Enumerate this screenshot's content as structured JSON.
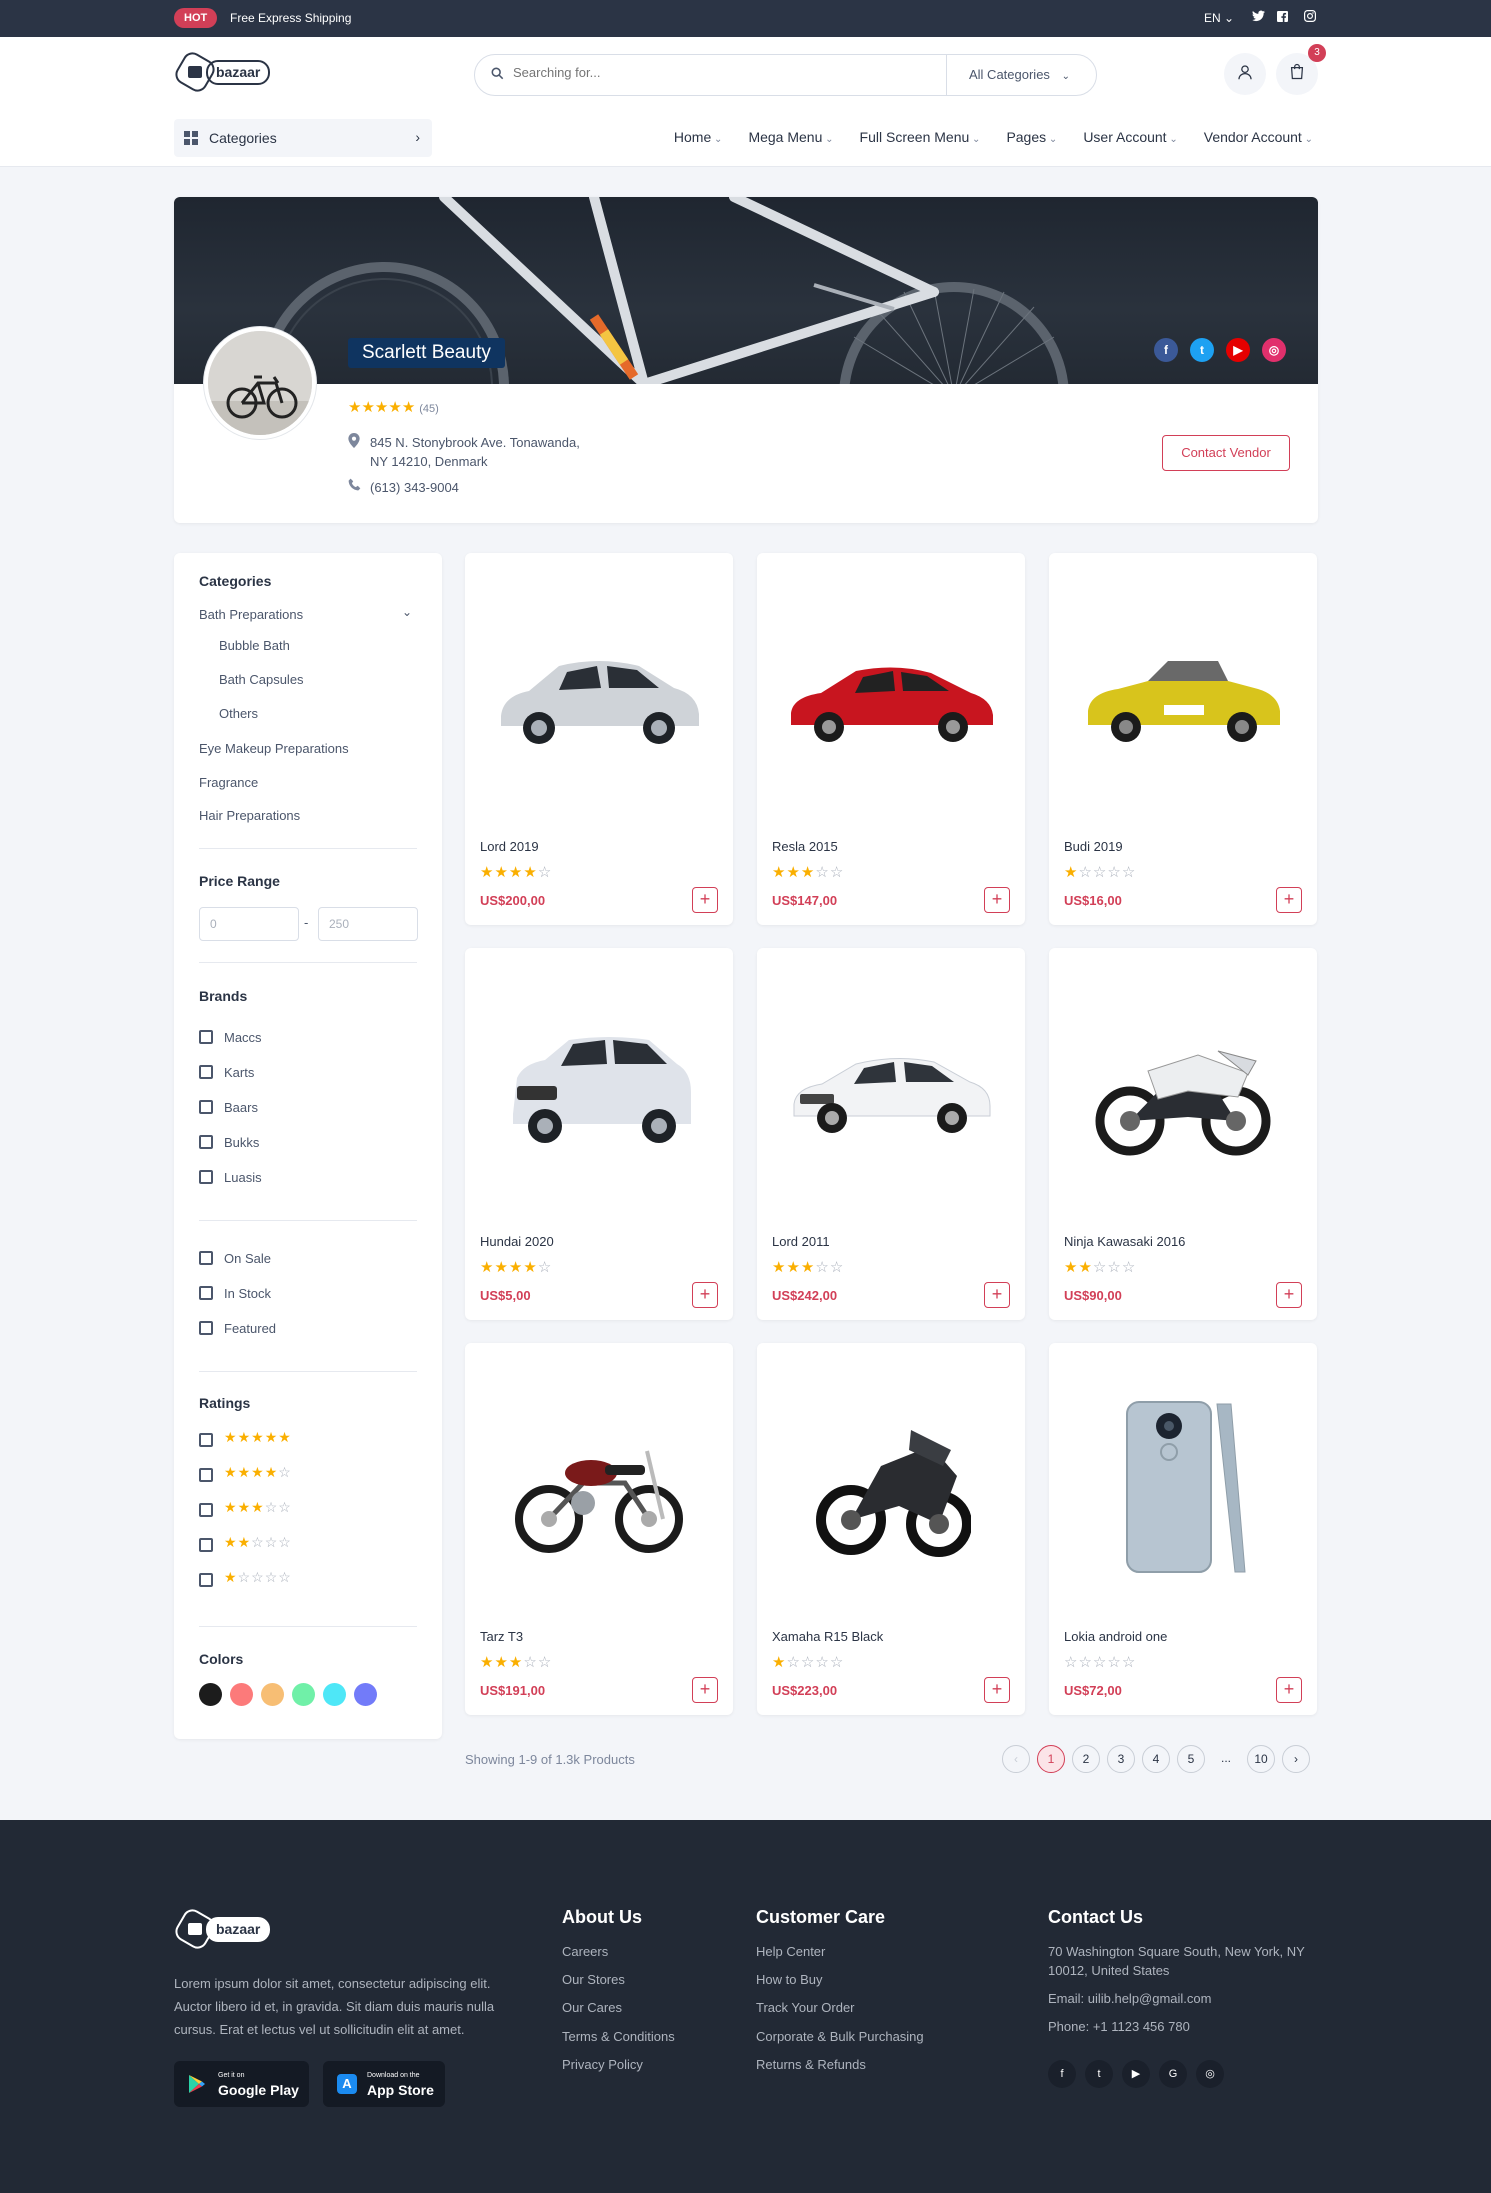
{
  "topbar": {
    "badge": "HOT",
    "shipping": "Free Express Shipping",
    "language": "EN"
  },
  "header": {
    "logo": "bazaar",
    "search_placeholder": "Searching for...",
    "search_category": "All Categories",
    "cart_count": "3"
  },
  "nav": {
    "categories_label": "Categories",
    "items": [
      "Home",
      "Mega Menu",
      "Full Screen Menu",
      "Pages",
      "User Account",
      "Vendor Account"
    ]
  },
  "shop": {
    "name": "Scarlett Beauty",
    "rating": 5,
    "review_count": "(45)",
    "address_line1": "845 N. Stonybrook Ave. Tonawanda,",
    "address_line2": "NY 14210, Denmark",
    "phone": "(613) 343-9004",
    "contact_label": "Contact Vendor"
  },
  "sidebar": {
    "categories_title": "Categories",
    "categories": [
      {
        "label": "Bath Preparations",
        "children": [
          "Bubble Bath",
          "Bath Capsules",
          "Others"
        ]
      },
      {
        "label": "Eye Makeup Preparations"
      },
      {
        "label": "Fragrance"
      },
      {
        "label": "Hair Preparations"
      }
    ],
    "price_title": "Price Range",
    "price_min_placeholder": "0",
    "price_max_placeholder": "250",
    "price_separator": "-",
    "brands_title": "Brands",
    "brands": [
      "Maccs",
      "Karts",
      "Baars",
      "Bukks",
      "Luasis"
    ],
    "flags": [
      "On Sale",
      "In Stock",
      "Featured"
    ],
    "ratings_title": "Ratings",
    "ratings": [
      5,
      4,
      3,
      2,
      1
    ],
    "colors_title": "Colors",
    "colors": [
      "#1c1c1c",
      "#fc7a7a",
      "#f7be74",
      "#70f0a8",
      "#4ee7f7",
      "#727bf9"
    ]
  },
  "products": [
    {
      "name": "Lord 2019",
      "rating": 4,
      "price": "US$200,00",
      "image": "silver-suv"
    },
    {
      "name": "Resla 2015",
      "rating": 3,
      "price": "US$147,00",
      "image": "red-coupe"
    },
    {
      "name": "Budi 2019",
      "rating": 1,
      "price": "US$16,00",
      "image": "yellow-roadster"
    },
    {
      "name": "Hundai 2020",
      "rating": 4,
      "price": "US$5,00",
      "image": "white-suv"
    },
    {
      "name": "Lord 2011",
      "rating": 3,
      "price": "US$242,00",
      "image": "white-sedan"
    },
    {
      "name": "Ninja Kawasaki 2016",
      "rating": 2,
      "price": "US$90,00",
      "image": "sport-bike"
    },
    {
      "name": "Tarz T3",
      "rating": 3,
      "price": "US$191,00",
      "image": "classic-motorcycle"
    },
    {
      "name": "Xamaha R15 Black",
      "rating": 1,
      "price": "US$223,00",
      "image": "black-sportbike"
    },
    {
      "name": "Lokia android one",
      "rating": 0,
      "price": "US$72,00",
      "image": "smartphone"
    }
  ],
  "pagination": {
    "showing": "Showing 1-9 of 1.3k Products",
    "prev": "‹",
    "next": "›",
    "pages": [
      "1",
      "2",
      "3",
      "4",
      "5",
      "...",
      "10"
    ],
    "current": "1"
  },
  "footer": {
    "logo": "bazaar",
    "description": "Lorem ipsum dolor sit amet, consectetur adipiscing elit. Auctor libero id et, in gravida. Sit diam duis mauris nulla cursus. Erat et lectus vel ut sollicitudin elit at amet.",
    "google_play_small": "Get it on",
    "google_play_big": "Google Play",
    "app_store_small": "Download on the",
    "app_store_big": "App Store",
    "about_title": "About Us",
    "about_links": [
      "Careers",
      "Our Stores",
      "Our Cares",
      "Terms & Conditions",
      "Privacy Policy"
    ],
    "care_title": "Customer Care",
    "care_links": [
      "Help Center",
      "How to Buy",
      "Track Your Order",
      "Corporate & Bulk Purchasing",
      "Returns & Refunds"
    ],
    "contact_title": "Contact Us",
    "contact_address_1": "70 Washington Square South, New York, NY",
    "contact_address_2": "10012, United States",
    "contact_email": "Email: uilib.help@gmail.com",
    "contact_phone": "Phone: +1 1123 456 780"
  },
  "colors": {
    "accent": "#d23f57",
    "dark": "#2b3445",
    "navy": "#0f3460",
    "star": "#faaf00"
  }
}
